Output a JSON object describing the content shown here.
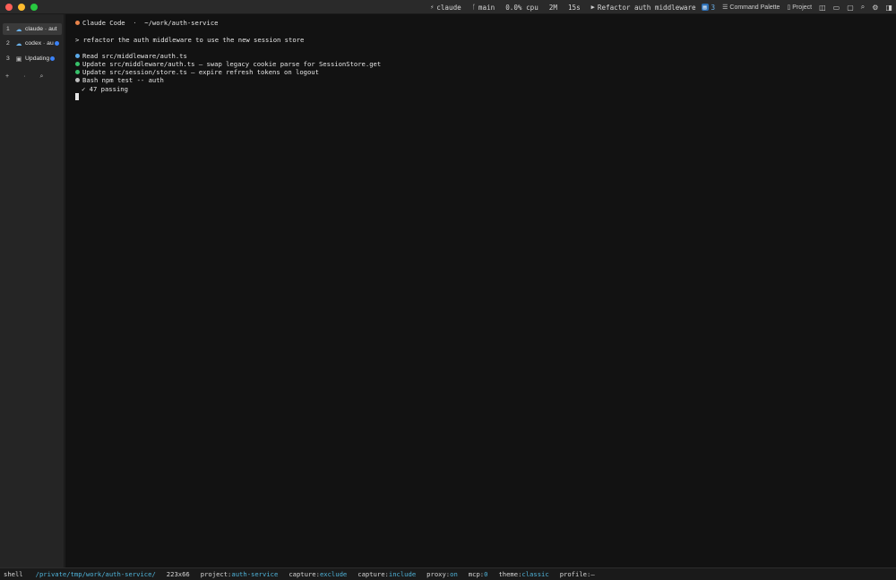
{
  "status_bar": {
    "agent": "claude",
    "branch": "main",
    "cpu": "0.0% cpu",
    "memory": "2M",
    "time": "15s",
    "task": "Refactor auth middleware",
    "task_count": "3",
    "command_palette": "Command Palette",
    "project": "Project"
  },
  "sidebar": {
    "sessions": [
      {
        "num": "1",
        "label": "claude · aut",
        "icon": "cloud-icon"
      },
      {
        "num": "2",
        "label": "codex · au",
        "icon": "cloud-icon"
      },
      {
        "num": "3",
        "label": "Updating",
        "icon": "terminal-icon"
      }
    ],
    "actions": [
      "+",
      "·",
      "⌕"
    ]
  },
  "terminal": {
    "header_app": "Claude Code",
    "header_sep": "·",
    "header_path": "~/work/auth-service",
    "prompt": "> refactor the auth middleware to use the new session store",
    "lines": [
      {
        "text": "Read src/middleware/auth.ts",
        "color": "#5aa8e8"
      },
      {
        "text": "Update src/middleware/auth.ts — swap legacy cookie parse for SessionStore.get",
        "color": "#37c06a"
      },
      {
        "text": "Update src/session/store.ts — expire refresh tokens on logout",
        "color": "#37c06a"
      },
      {
        "text": "Bash npm test -- auth",
        "color": "#bdbdbd"
      }
    ],
    "result": "✓ 47 passing"
  },
  "bottom_bar": {
    "mode": "shell",
    "path": "/private/tmp/work/auth-service/",
    "size": "223x66",
    "project_label": "project:",
    "project_value": "auth-service",
    "capture1_label": "capture:",
    "capture1_value": "exclude",
    "capture2_label": "capture:",
    "capture2_value": "include",
    "proxy_label": "proxy:",
    "proxy_value": "on",
    "mcp_label": "mcp:",
    "mcp_value": "0",
    "theme_label": "theme:",
    "theme_value": "classic",
    "profile_label": "profile:",
    "profile_value": "—"
  }
}
